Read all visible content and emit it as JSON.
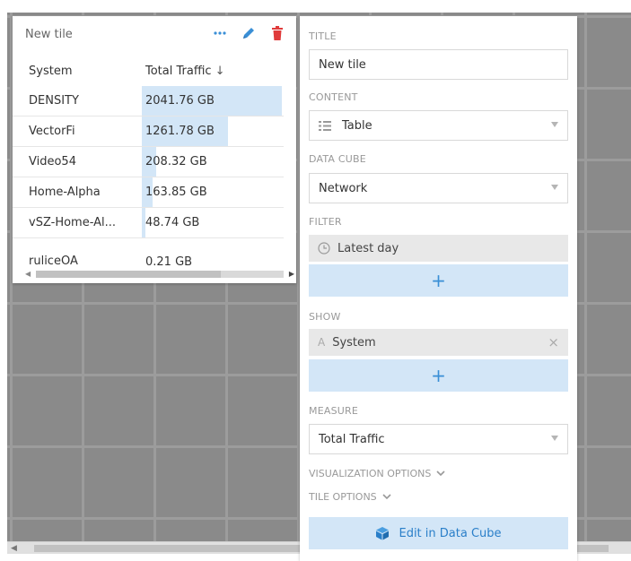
{
  "tile": {
    "title": "New tile",
    "columns": {
      "system": "System",
      "measure": "Total Traffic",
      "sort_glyph": "↓"
    },
    "rows": [
      {
        "system": "DENSITY",
        "value": "2041.76 GB",
        "fraction": 1.0
      },
      {
        "system": "VectorFi",
        "value": "1261.78 GB",
        "fraction": 0.618
      },
      {
        "system": "Video54",
        "value": "208.32 GB",
        "fraction": 0.102
      },
      {
        "system": "Home-Alpha",
        "value": "163.85 GB",
        "fraction": 0.08
      },
      {
        "system": "vSZ-Home-Al...",
        "value": "48.74 GB",
        "fraction": 0.024
      }
    ],
    "partial_row": {
      "system": "ruliceOA",
      "value": "0.21 GB"
    }
  },
  "panel": {
    "title_label": "TITLE",
    "title_value": "New tile",
    "content_label": "CONTENT",
    "content_value": "Table",
    "datacube_label": "DATA CUBE",
    "datacube_value": "Network",
    "filter_label": "FILTER",
    "filter_value": "Latest day",
    "add_glyph": "+",
    "show_label": "SHOW",
    "show_value": "System",
    "show_type_glyph": "A",
    "remove_glyph": "×",
    "measure_label": "MEASURE",
    "measure_value": "Total Traffic",
    "visualization_options": "VISUALIZATION OPTIONS",
    "tile_options": "TILE OPTIONS",
    "edit_button": "Edit in Data Cube"
  },
  "colors": {
    "accent": "#3a8fd6",
    "bar": "#d3e6f7",
    "delete": "#e03b3b",
    "background": "#8a8a8a"
  },
  "icons": {
    "more": "more-dots-icon",
    "edit": "pencil-icon",
    "delete": "trash-icon",
    "table": "table-icon",
    "clock": "clock-icon",
    "cube": "cube-icon",
    "chevron": "chevron-down-icon"
  }
}
